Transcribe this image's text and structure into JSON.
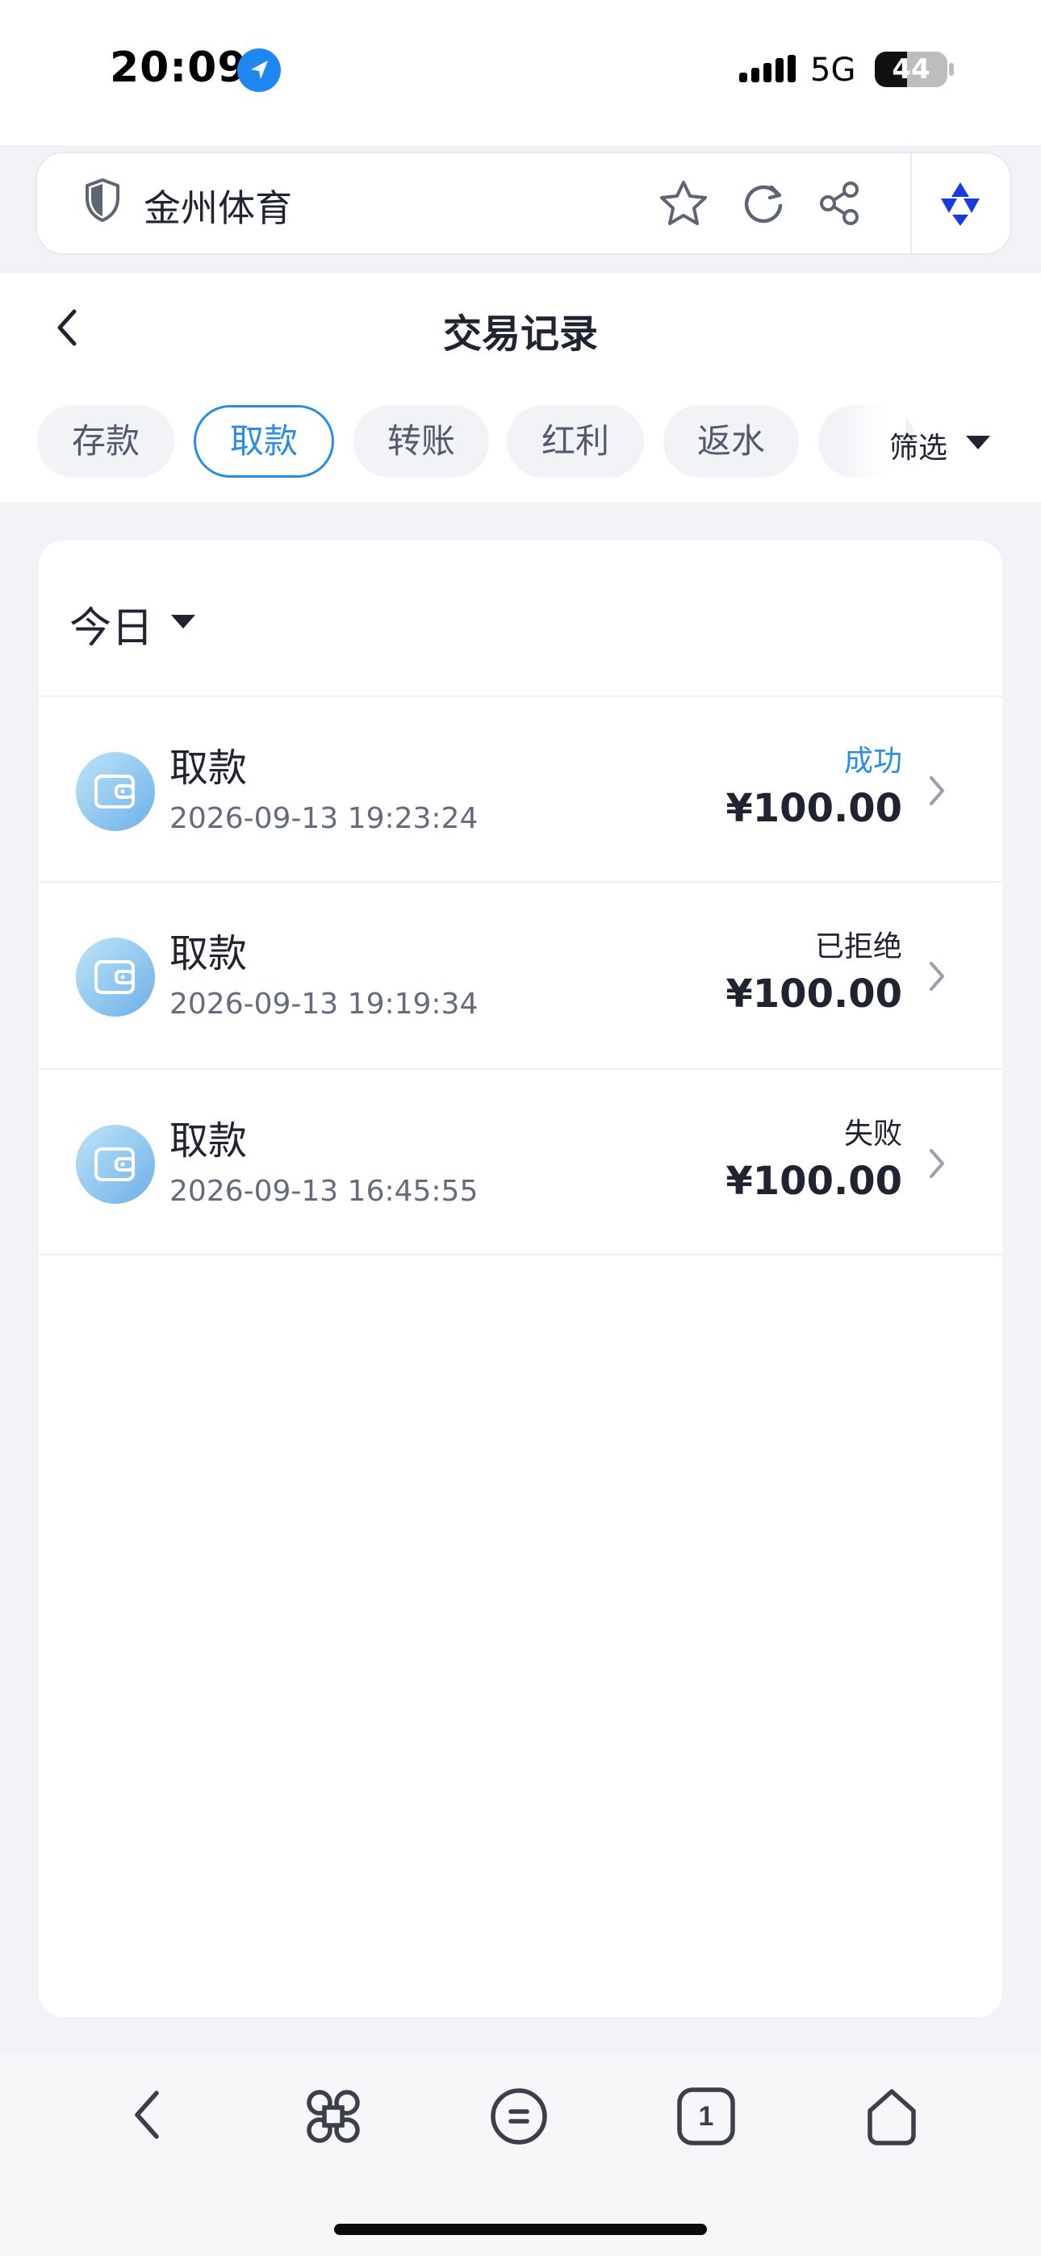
{
  "status_bar": {
    "time": "20:09",
    "network": "5G",
    "battery": "44",
    "battery_level": 0.44
  },
  "browser": {
    "site_name": "金州体育"
  },
  "page": {
    "title": "交易记录"
  },
  "tabs": [
    {
      "label": "存款",
      "active": false
    },
    {
      "label": "取款",
      "active": true
    },
    {
      "label": "转账",
      "active": false
    },
    {
      "label": "红利",
      "active": false
    },
    {
      "label": "返水",
      "active": false
    }
  ],
  "filter": {
    "label": "筛选"
  },
  "period": {
    "label": "今日"
  },
  "records": [
    {
      "title": "取款",
      "time": "2026-09-13 19:23:24",
      "status": "成功",
      "status_color": "#2b8ce6",
      "amount": "¥100.00"
    },
    {
      "title": "取款",
      "time": "2026-09-13 19:19:34",
      "status": "已拒绝",
      "status_color": "#1f2430",
      "amount": "¥100.00"
    },
    {
      "title": "取款",
      "time": "2026-09-13 16:45:55",
      "status": "失败",
      "status_color": "#1f2430",
      "amount": "¥100.00"
    }
  ],
  "toolbar": {
    "tab_count": "1"
  },
  "colors": {
    "accent": "#2b8ce6",
    "background": "#f2f3f7"
  }
}
